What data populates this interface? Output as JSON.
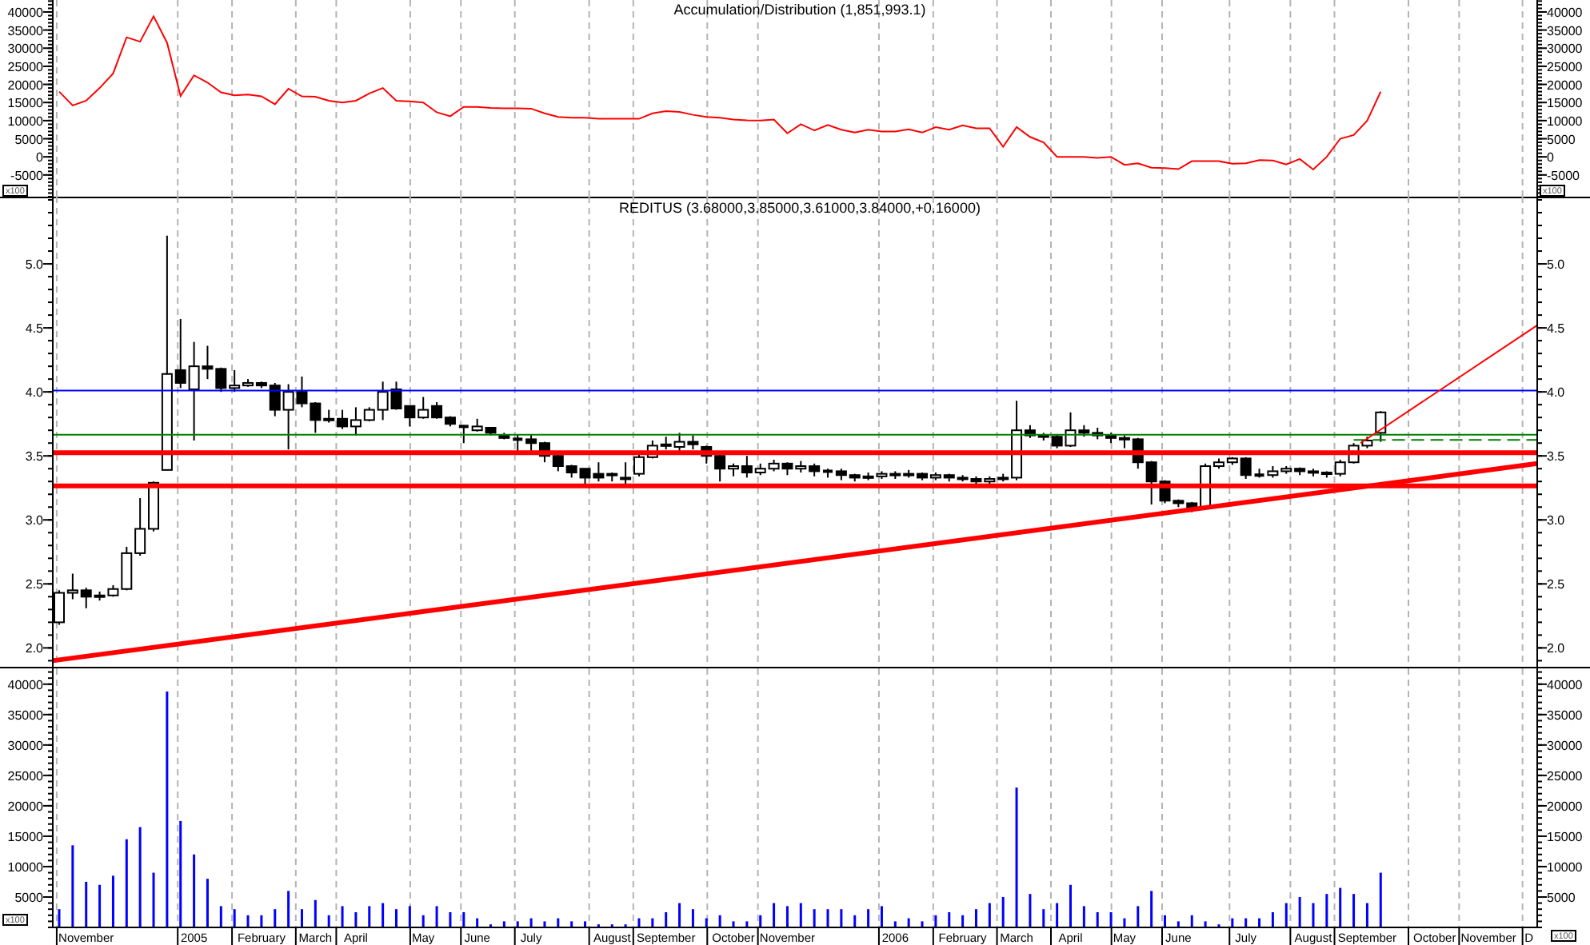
{
  "accumulation_panel": {
    "multiplier_labels": [
      "x100",
      "x100"
    ],
    "right_axis_labels": [
      "40000",
      "35000",
      "30000",
      "25000",
      "20000",
      "15000",
      "10000",
      "5000",
      "0",
      "-5000"
    ],
    "chart_data": {
      "type": "line",
      "title": "Accumulation/Distribution (1,851,993.1)",
      "grid": true,
      "ylim": [
        -11000,
        43300
      ],
      "yticks": [
        40000,
        35000,
        30000,
        25000,
        20000,
        15000,
        10000,
        5000,
        0,
        -5000
      ],
      "categories": [
        null,
        null,
        null,
        null,
        null,
        null,
        null,
        null,
        null,
        null,
        null,
        null,
        null,
        null,
        null,
        null,
        null,
        null,
        null,
        null,
        null,
        null,
        null,
        null,
        null,
        null,
        null,
        null,
        null,
        null,
        null,
        null,
        null,
        null,
        null,
        null,
        null,
        null,
        null,
        null,
        null,
        null,
        null,
        null,
        null,
        null,
        null,
        null,
        null,
        null,
        null,
        null,
        null,
        null,
        null,
        null,
        null,
        null,
        null,
        null,
        null,
        null,
        null,
        null,
        null,
        null,
        null,
        null,
        null,
        null,
        null,
        null,
        null,
        null,
        null,
        null,
        null,
        null,
        null,
        null,
        null,
        null,
        null,
        null,
        null,
        null,
        null,
        null,
        null,
        null,
        null,
        null,
        null,
        null,
        null,
        null,
        null,
        null,
        null
      ],
      "series": [
        {
          "color": "#ff0000",
          "values": [
            18000,
            14200,
            15500,
            19000,
            23000,
            33000,
            31800,
            38800,
            31500,
            16800,
            22500,
            20500,
            17800,
            17000,
            17200,
            16700,
            14500,
            18800,
            16700,
            16600,
            15500,
            15000,
            15500,
            17500,
            19000,
            15500,
            15300,
            15000,
            12300,
            11200,
            13800,
            13800,
            13500,
            13400,
            13400,
            13300,
            12000,
            11000,
            10800,
            10800,
            10500,
            10500,
            10500,
            10500,
            12000,
            12600,
            12400,
            11600,
            11000,
            10800,
            10300,
            10100,
            10000,
            10300,
            6500,
            9000,
            7300,
            8800,
            7500,
            6700,
            7500,
            7000,
            7000,
            7600,
            6700,
            8200,
            7500,
            8700,
            7900,
            7900,
            2800,
            8200,
            5500,
            4000,
            0,
            0,
            0,
            -300,
            0,
            -2200,
            -1800,
            -3000,
            -3100,
            -3400,
            -1200,
            -1200,
            -1200,
            -1900,
            -1800,
            -900,
            -1000,
            -2100,
            -600,
            -3500,
            0,
            5000,
            6000,
            10000,
            18000
          ]
        }
      ]
    }
  },
  "price_panel": {
    "right_axis_labels": [
      "5.0",
      "4.5",
      "4.0",
      "3.5",
      "3.0",
      "2.5",
      "2.0"
    ],
    "chart_data": {
      "type": "candlestick",
      "title": "REDITUS (3.68000,3.85000,3.61000,3.84000,+0.16000)",
      "grid": true,
      "ylim": [
        1.84,
        5.525
      ],
      "yticks": [
        {
          "value": 5,
          "label": "5.0"
        },
        {
          "value": 4.5,
          "label": "4.5"
        },
        {
          "value": 4,
          "label": "4.0"
        },
        {
          "value": 3.5,
          "label": "3.5"
        },
        {
          "value": 3,
          "label": "3.0"
        },
        {
          "value": 2.5,
          "label": "2.5"
        },
        {
          "value": 2,
          "label": "2.0"
        }
      ],
      "categories": [
        null,
        null,
        null,
        null,
        null,
        null,
        null,
        null,
        null,
        null,
        null,
        null,
        null,
        null,
        null,
        null,
        null,
        null,
        null,
        null,
        null,
        null,
        null,
        null,
        null,
        null,
        null,
        null,
        null,
        null,
        null,
        null,
        null,
        null,
        null,
        null,
        null,
        null,
        null,
        null,
        null,
        null,
        null,
        null,
        null,
        null,
        null,
        null,
        null,
        null,
        null,
        null,
        null,
        null,
        null,
        null,
        null,
        null,
        null,
        null,
        null,
        null,
        null,
        null,
        null,
        null,
        null,
        null,
        null,
        null,
        null,
        null,
        null,
        null,
        null,
        null,
        null,
        null,
        null,
        null,
        null,
        null,
        null,
        null,
        null,
        null,
        null,
        null,
        null,
        null,
        null,
        null,
        null,
        null,
        null,
        null,
        null,
        null,
        null
      ],
      "ohlc": [
        [
          2.2,
          2.45,
          2.18,
          2.43
        ],
        [
          2.43,
          2.58,
          2.38,
          2.45
        ],
        [
          2.45,
          2.47,
          2.31,
          2.4
        ],
        [
          2.4,
          2.44,
          2.37,
          2.41
        ],
        [
          2.41,
          2.49,
          2.4,
          2.46
        ],
        [
          2.46,
          2.79,
          2.45,
          2.74
        ],
        [
          2.74,
          3.17,
          2.72,
          2.93
        ],
        [
          2.93,
          3.3,
          2.91,
          3.29
        ],
        [
          3.39,
          5.22,
          3.39,
          4.14
        ],
        [
          4.17,
          4.57,
          4.03,
          4.07
        ],
        [
          4.02,
          4.39,
          3.62,
          4.2
        ],
        [
          4.2,
          4.36,
          4.1,
          4.18
        ],
        [
          4.18,
          4.19,
          4.0,
          4.03
        ],
        [
          4.03,
          4.17,
          4.0,
          4.05
        ],
        [
          4.05,
          4.1,
          4.04,
          4.07
        ],
        [
          4.07,
          4.08,
          4.03,
          4.05
        ],
        [
          4.05,
          4.07,
          3.81,
          3.86
        ],
        [
          3.86,
          4.06,
          3.55,
          4.0
        ],
        [
          4.0,
          4.12,
          3.88,
          3.91
        ],
        [
          3.91,
          3.92,
          3.68,
          3.78
        ],
        [
          3.78,
          3.86,
          3.76,
          3.79
        ],
        [
          3.79,
          3.86,
          3.71,
          3.73
        ],
        [
          3.73,
          3.88,
          3.66,
          3.78
        ],
        [
          3.78,
          3.88,
          3.77,
          3.86
        ],
        [
          3.86,
          4.08,
          3.78,
          4.0
        ],
        [
          4.02,
          4.08,
          3.86,
          3.87
        ],
        [
          3.89,
          3.89,
          3.73,
          3.8
        ],
        [
          3.8,
          3.96,
          3.79,
          3.86
        ],
        [
          3.89,
          3.92,
          3.79,
          3.8
        ],
        [
          3.8,
          3.81,
          3.73,
          3.75
        ],
        [
          3.73,
          3.74,
          3.6,
          3.73
        ],
        [
          3.7,
          3.79,
          3.69,
          3.73
        ],
        [
          3.72,
          3.72,
          3.66,
          3.68
        ],
        [
          3.66,
          3.68,
          3.63,
          3.64
        ],
        [
          3.63,
          3.67,
          3.54,
          3.63
        ],
        [
          3.63,
          3.67,
          3.54,
          3.6
        ],
        [
          3.6,
          3.61,
          3.45,
          3.5
        ],
        [
          3.5,
          3.51,
          3.38,
          3.42
        ],
        [
          3.42,
          3.43,
          3.33,
          3.37
        ],
        [
          3.4,
          3.4,
          3.28,
          3.33
        ],
        [
          3.36,
          3.45,
          3.3,
          3.33
        ],
        [
          3.36,
          3.37,
          3.3,
          3.35
        ],
        [
          3.32,
          3.45,
          3.26,
          3.33
        ],
        [
          3.36,
          3.51,
          3.34,
          3.49
        ],
        [
          3.49,
          3.62,
          3.48,
          3.58
        ],
        [
          3.58,
          3.65,
          3.55,
          3.59
        ],
        [
          3.57,
          3.68,
          3.54,
          3.61
        ],
        [
          3.61,
          3.66,
          3.55,
          3.59
        ],
        [
          3.57,
          3.58,
          3.44,
          3.5
        ],
        [
          3.5,
          3.51,
          3.3,
          3.4
        ],
        [
          3.4,
          3.44,
          3.34,
          3.42
        ],
        [
          3.42,
          3.5,
          3.33,
          3.37
        ],
        [
          3.37,
          3.44,
          3.35,
          3.4
        ],
        [
          3.4,
          3.47,
          3.38,
          3.44
        ],
        [
          3.44,
          3.45,
          3.35,
          3.4
        ],
        [
          3.4,
          3.46,
          3.37,
          3.42
        ],
        [
          3.42,
          3.44,
          3.34,
          3.38
        ],
        [
          3.38,
          3.4,
          3.33,
          3.38
        ],
        [
          3.38,
          3.4,
          3.31,
          3.35
        ],
        [
          3.35,
          3.36,
          3.3,
          3.33
        ],
        [
          3.33,
          3.37,
          3.31,
          3.34
        ],
        [
          3.34,
          3.38,
          3.32,
          3.36
        ],
        [
          3.36,
          3.38,
          3.32,
          3.35
        ],
        [
          3.35,
          3.39,
          3.33,
          3.36
        ],
        [
          3.36,
          3.37,
          3.31,
          3.33
        ],
        [
          3.33,
          3.37,
          3.31,
          3.35
        ],
        [
          3.35,
          3.36,
          3.3,
          3.33
        ],
        [
          3.33,
          3.35,
          3.3,
          3.32
        ],
        [
          3.32,
          3.34,
          3.28,
          3.3
        ],
        [
          3.3,
          3.34,
          3.28,
          3.32
        ],
        [
          3.32,
          3.36,
          3.3,
          3.33
        ],
        [
          3.33,
          3.93,
          3.31,
          3.7
        ],
        [
          3.7,
          3.74,
          3.64,
          3.66
        ],
        [
          3.66,
          3.68,
          3.62,
          3.65
        ],
        [
          3.65,
          3.67,
          3.56,
          3.58
        ],
        [
          3.58,
          3.84,
          3.57,
          3.7
        ],
        [
          3.7,
          3.74,
          3.65,
          3.68
        ],
        [
          3.68,
          3.72,
          3.63,
          3.66
        ],
        [
          3.66,
          3.68,
          3.6,
          3.64
        ],
        [
          3.64,
          3.66,
          3.56,
          3.63
        ],
        [
          3.63,
          3.64,
          3.4,
          3.45
        ],
        [
          3.45,
          3.46,
          3.12,
          3.3
        ],
        [
          3.3,
          3.31,
          3.13,
          3.15
        ],
        [
          3.15,
          3.16,
          3.1,
          3.13
        ],
        [
          3.13,
          3.14,
          3.06,
          3.09
        ],
        [
          3.09,
          3.44,
          3.08,
          3.42
        ],
        [
          3.42,
          3.48,
          3.4,
          3.45
        ],
        [
          3.45,
          3.49,
          3.43,
          3.48
        ],
        [
          3.48,
          3.49,
          3.32,
          3.35
        ],
        [
          3.35,
          3.4,
          3.33,
          3.35
        ],
        [
          3.35,
          3.42,
          3.33,
          3.38
        ],
        [
          3.38,
          3.42,
          3.36,
          3.4
        ],
        [
          3.4,
          3.41,
          3.35,
          3.38
        ],
        [
          3.38,
          3.4,
          3.34,
          3.37
        ],
        [
          3.37,
          3.38,
          3.33,
          3.36
        ],
        [
          3.36,
          3.47,
          3.34,
          3.45
        ],
        [
          3.45,
          3.6,
          3.44,
          3.58
        ],
        [
          3.58,
          3.65,
          3.56,
          3.62
        ],
        [
          3.68,
          3.85,
          3.61,
          3.84
        ]
      ],
      "ref_lines": [
        {
          "axis": "y",
          "value": 4.01,
          "color": "#0000ff"
        },
        {
          "axis": "y",
          "value": 3.665,
          "color": "#008000"
        },
        {
          "axis": "y",
          "value": 3.525,
          "color": "#ff0000"
        },
        {
          "axis": "y",
          "value": 3.265,
          "color": "#ff0000"
        }
      ]
    }
  },
  "volume_panel": {
    "multiplier_labels": [
      "x100",
      "x100"
    ],
    "right_axis_labels": [
      "40000",
      "35000",
      "30000",
      "25000",
      "20000",
      "15000",
      "10000",
      "5000"
    ],
    "chart_data": {
      "type": "bar",
      "grid": true,
      "ylim": [
        0,
        42600
      ],
      "yticks": [
        40000,
        35000,
        30000,
        25000,
        20000,
        15000,
        10000,
        5000
      ],
      "categories": [
        null,
        null,
        "November",
        null,
        null,
        null,
        null,
        null,
        null,
        null,
        "2005",
        null,
        null,
        null,
        null,
        "February",
        null,
        null,
        null,
        "March",
        null,
        null,
        "April",
        null,
        null,
        null,
        null,
        "May",
        null,
        null,
        null,
        "June",
        null,
        null,
        null,
        "July",
        null,
        null,
        null,
        null,
        null,
        "August",
        null,
        null,
        null,
        "September",
        null,
        null,
        null,
        null,
        "October",
        null,
        null,
        null,
        "November",
        null,
        null,
        null,
        null,
        null,
        null,
        null,
        "2006",
        null,
        null,
        null,
        null,
        "February",
        null,
        null,
        null,
        "March",
        null,
        null,
        null,
        "April",
        null,
        null,
        null,
        "May",
        null,
        null,
        null,
        "June",
        null,
        null,
        null,
        null,
        "July",
        null,
        null,
        null,
        null,
        "August",
        null,
        null,
        null,
        "September",
        null,
        null,
        null,
        null,
        "October",
        null,
        null,
        null,
        "November",
        null,
        null,
        "D"
      ],
      "series": [
        {
          "color": "#0000ff",
          "values": [
            3000,
            13500,
            7500,
            7000,
            8500,
            14500,
            16500,
            9000,
            38800,
            17500,
            12000,
            8000,
            3500,
            3000,
            2000,
            2000,
            3000,
            6000,
            3000,
            4500,
            2000,
            3500,
            2500,
            3500,
            4000,
            3000,
            3500,
            2000,
            3500,
            2500,
            2500,
            1500,
            500,
            1000,
            1000,
            1500,
            1000,
            1500,
            1000,
            1000,
            500,
            500,
            500,
            1500,
            1500,
            2500,
            4000,
            3000,
            1500,
            2000,
            1000,
            1000,
            2000,
            4000,
            3500,
            4000,
            3000,
            3000,
            3000,
            2000,
            3000,
            3500,
            1000,
            1500,
            1000,
            2000,
            2500,
            2000,
            3000,
            4000,
            5000,
            23000,
            5500,
            3000,
            4000,
            7000,
            3500,
            2500,
            2500,
            1500,
            3500,
            6000,
            2000,
            1000,
            2000,
            1000,
            500,
            1500,
            1500,
            1500,
            2500,
            4000,
            5000,
            4000,
            5500,
            6500,
            5500,
            4000,
            9000,
            null,
            null,
            null,
            null,
            null,
            null,
            null,
            null,
            null,
            null,
            null
          ]
        }
      ]
    }
  }
}
